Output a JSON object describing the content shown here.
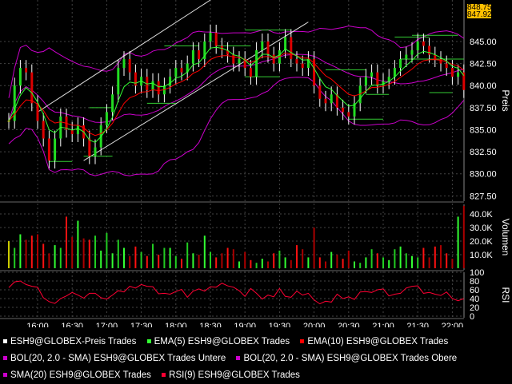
{
  "chart_data": {
    "type": "line",
    "title": "",
    "panels": [
      {
        "name": "Preis",
        "ylim": [
          826.9,
          849.7
        ],
        "ticks": [
          827.5,
          830,
          832.5,
          835,
          837.5,
          840,
          842.5,
          845
        ],
        "tick_labels": [
          "827.50",
          "830.00",
          "832.50",
          "835.00",
          "837.50",
          "840.00",
          "842.50",
          "845.00"
        ],
        "last_prices": [
          "848.75",
          "847.92"
        ]
      },
      {
        "name": "Volumen",
        "ylim": [
          0,
          47
        ],
        "ticks": [
          10,
          20,
          30,
          40
        ],
        "tick_labels": [
          "10.0K",
          "20.0K",
          "30.0K",
          "40.0K"
        ]
      },
      {
        "name": "RSI",
        "ylim": [
          0,
          100
        ],
        "ticks": [
          0,
          20,
          40,
          60,
          80,
          100
        ],
        "tick_labels": [
          "0",
          "20",
          "40",
          "60",
          "80",
          "100"
        ]
      }
    ],
    "x_tick_index": [
      5,
      11,
      17,
      23,
      29,
      35,
      41,
      47,
      53,
      59,
      65,
      71,
      77
    ],
    "x_tick_labels": [
      "16:00",
      "16:30",
      "17:00",
      "17:30",
      "18:00",
      "18:30",
      "19:00",
      "19:30",
      "20:00",
      "20:30",
      "21:00",
      "21:30",
      "22:00"
    ],
    "bar_interval_min": 5,
    "close": [
      836,
      840,
      842,
      841.5,
      838,
      836,
      834,
      831.5,
      834,
      836.5,
      835,
      834.5,
      835.5,
      834,
      832,
      833,
      835.5,
      837,
      839,
      842,
      843,
      841.5,
      840,
      841,
      839.5,
      840.5,
      839,
      840,
      841,
      842,
      841.5,
      842.5,
      844,
      843,
      845,
      846,
      844.5,
      844,
      843.5,
      842.5,
      843,
      842,
      841,
      844,
      845,
      843.5,
      842.5,
      844,
      845.5,
      843,
      842.5,
      842,
      843,
      840,
      838.5,
      838,
      839,
      837.5,
      837,
      836.5,
      838,
      840,
      841,
      841.5,
      840,
      840.5,
      841,
      842,
      843,
      843.5,
      844,
      845,
      844.5,
      843.5,
      843,
      842.5,
      842,
      841,
      841.5,
      839.5
    ],
    "wick": 0.9,
    "volume_k": [
      20,
      15,
      25,
      21,
      24,
      25,
      18,
      11,
      17,
      15,
      38,
      23,
      35,
      22,
      21,
      24,
      13,
      26,
      11,
      21,
      15,
      9,
      16,
      12,
      9,
      18,
      10,
      15,
      15,
      9,
      7,
      19,
      11,
      10,
      24,
      12,
      8,
      11,
      15,
      14,
      5,
      12,
      6,
      4,
      7,
      5,
      11,
      13,
      8,
      6,
      17,
      14,
      8,
      30,
      8,
      5,
      12,
      10,
      7,
      13,
      5,
      4,
      8,
      14,
      11,
      8,
      6,
      14,
      16,
      11,
      9,
      8,
      15,
      8,
      16,
      17,
      11,
      7,
      38,
      46
    ],
    "rsi": [
      65,
      78,
      80,
      72,
      68,
      66,
      42,
      33,
      29,
      40,
      46,
      54,
      48,
      41,
      52,
      52,
      42,
      39,
      48,
      58,
      55,
      68,
      64,
      72,
      68,
      67,
      51,
      52,
      50,
      56,
      61,
      43,
      57,
      62,
      57,
      67,
      66,
      75,
      69,
      66,
      58,
      45,
      63,
      52,
      39,
      48,
      44,
      63,
      45,
      43,
      57,
      48,
      52,
      37,
      28,
      34,
      32,
      50,
      40,
      44,
      38,
      55,
      56,
      54,
      60,
      62,
      46,
      50,
      52,
      64,
      68,
      69,
      52,
      54,
      50,
      47,
      55,
      40,
      35,
      40
    ],
    "trendlines": [
      [
        5,
        837,
        35,
        849.7
      ],
      [
        13,
        831.5,
        52,
        847.2
      ]
    ],
    "levels": [
      [
        7,
        11,
        831.4
      ],
      [
        13,
        18,
        832
      ],
      [
        14,
        18,
        837.5
      ],
      [
        24,
        29,
        838
      ],
      [
        27,
        33,
        844.5
      ],
      [
        36,
        42,
        844.5
      ],
      [
        41,
        47,
        841
      ],
      [
        41,
        49,
        846.3
      ],
      [
        55,
        62,
        841.8
      ],
      [
        59,
        65,
        836.2
      ],
      [
        62,
        66,
        839
      ],
      [
        67,
        73,
        845.5
      ],
      [
        68,
        79,
        843
      ],
      [
        70,
        78,
        845.7
      ],
      [
        73,
        77,
        839.2
      ]
    ],
    "legend": [
      {
        "label": "ESH9@GLOBEX-Preis Trades",
        "color": "#ffffff"
      },
      {
        "label": "EMA(5) ESH9@GLOBEX Trades",
        "color": "#33ff33"
      },
      {
        "label": "EMA(10) ESH9@GLOBEX Trades",
        "color": "#ff0000"
      },
      {
        "label": "BOL(20, 2.0 - SMA) ESH9@GLOBEX Trades Untere",
        "color": "#cc00cc"
      },
      {
        "label": "BOL(20, 2.0 - SMA) ESH9@GLOBEX Trades Obere",
        "color": "#cc00cc"
      },
      {
        "label": "SMA(20) ESH9@GLOBEX Trades",
        "color": "#cc00cc"
      },
      {
        "label": "RSI(9) ESH9@GLOBEX Trades",
        "color": "#ff0033"
      }
    ]
  }
}
